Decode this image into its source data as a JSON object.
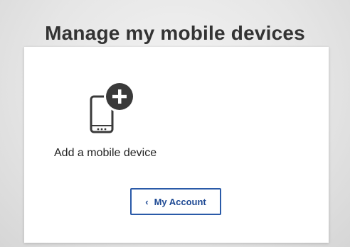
{
  "page": {
    "title": "Manage my mobile devices"
  },
  "devices": {
    "add_label": "Add a mobile device",
    "add_icon": "mobile-add-icon"
  },
  "account_button": {
    "label": "My Account",
    "icon": "chevron-left-icon"
  },
  "colors": {
    "accent": "#2a5aa8",
    "icon_dark": "#3a3a3a",
    "text": "#333333"
  }
}
